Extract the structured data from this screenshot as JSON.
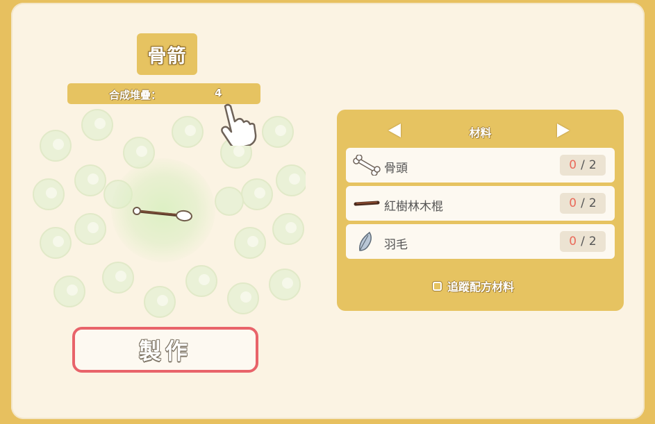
{
  "item": {
    "name": "骨箭",
    "stack_label": "合成堆疊：",
    "stack_value": "4",
    "icon": "bone-arrow-icon"
  },
  "craft_button": {
    "label": "製作"
  },
  "materials": {
    "title": "材料",
    "prev_icon": "triangle-left-icon",
    "next_icon": "triangle-right-icon",
    "items": [
      {
        "name": "骨頭",
        "icon": "bone-icon",
        "have": "0",
        "sep": "/",
        "need": "2"
      },
      {
        "name": "紅樹林木棍",
        "icon": "stick-icon",
        "have": "0",
        "sep": "/",
        "need": "2"
      },
      {
        "name": "羽毛",
        "icon": "feather-icon",
        "have": "0",
        "sep": "/",
        "need": "2"
      }
    ],
    "track_label": "追蹤配方材料",
    "track_checked": false
  },
  "colors": {
    "frame": "#e7c05f",
    "panel": "#fbf3e3",
    "accent_red": "#e8636a",
    "count_have": "#ea6a5a"
  }
}
